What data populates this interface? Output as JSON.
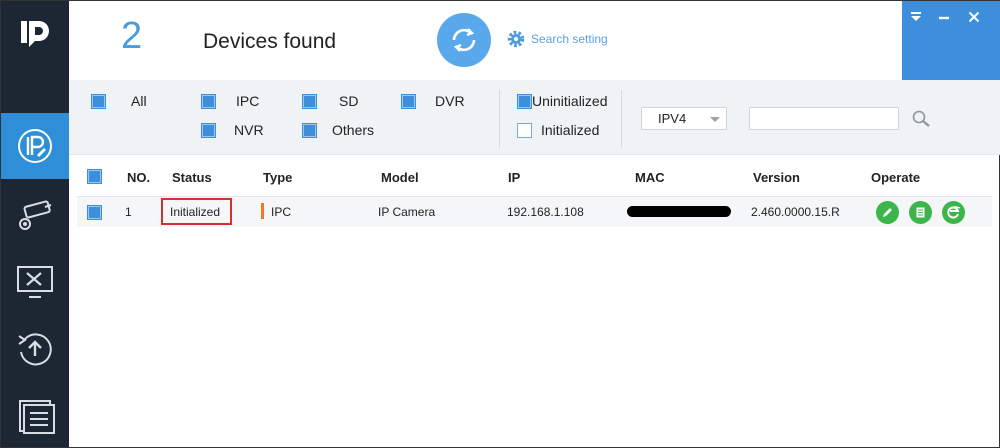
{
  "header": {
    "device_count": "2",
    "devices_found_label": "Devices found",
    "search_setting_label": "Search setting"
  },
  "filters": {
    "all_label": "All",
    "ipc_label": "IPC",
    "sd_label": "SD",
    "dvr_label": "DVR",
    "nvr_label": "NVR",
    "others_label": "Others",
    "uninitialized_label": "Uninitialized",
    "initialized_label": "Initialized",
    "ip_version": "IPV4",
    "search_value": ""
  },
  "table": {
    "columns": {
      "no": "NO.",
      "status": "Status",
      "type": "Type",
      "model": "Model",
      "ip": "IP",
      "mac": "MAC",
      "version": "Version",
      "operate": "Operate"
    },
    "rows": [
      {
        "no": "1",
        "status": "Initialized",
        "type": "IPC",
        "model": "IP Camera",
        "ip": "192.168.1.108",
        "version": "2.460.0000.15.R"
      }
    ]
  },
  "colors": {
    "sidebar": "#1c2733",
    "accent": "#3d8fdb",
    "status_highlight": "#d43030",
    "operate_green": "#3cb54a",
    "type_marker": "#f07a20"
  },
  "icons": {
    "sidebar": [
      "ip-config-icon",
      "camera-settings-icon",
      "tools-icon",
      "upgrade-icon",
      "list-icon"
    ],
    "operate": [
      "edit-icon",
      "details-icon",
      "web-browser-icon"
    ]
  }
}
